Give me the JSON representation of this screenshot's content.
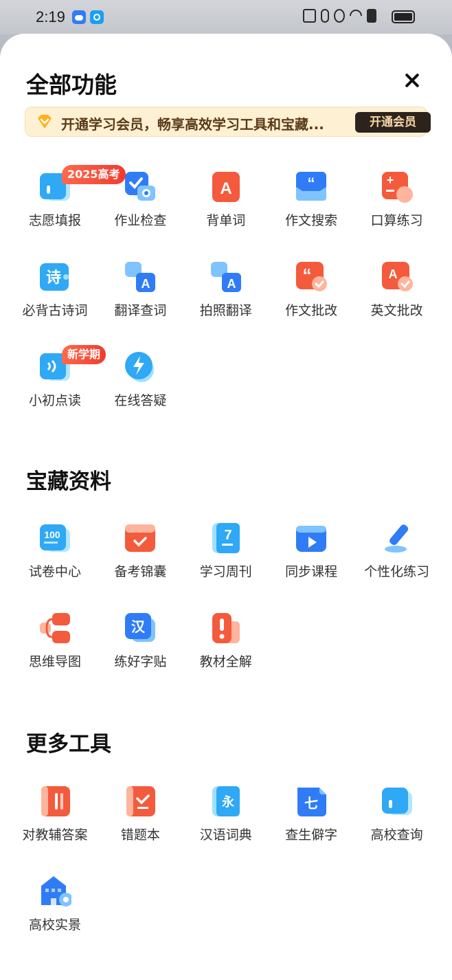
{
  "status_bar": {
    "time": "2:19",
    "icons": [
      "cloud-icon",
      "search-app-icon",
      "nfc-icon",
      "bluetooth-icon",
      "mute-icon",
      "wifi-icon",
      "alert-icon",
      "battery-icon"
    ]
  },
  "header": {
    "title": "全部功能",
    "close_icon": "close-icon"
  },
  "vip_banner": {
    "text": "开通学习会员，畅享高效学习工具和宝藏...",
    "button": "开通会员"
  },
  "functions": [
    {
      "label": "志愿填报",
      "icon": "volunteer-icon",
      "badge": "2025高考"
    },
    {
      "label": "作业检查",
      "icon": "homework-check-icon"
    },
    {
      "label": "背单词",
      "icon": "vocab-icon"
    },
    {
      "label": "作文搜索",
      "icon": "essay-search-icon"
    },
    {
      "label": "口算练习",
      "icon": "mental-math-icon"
    },
    {
      "label": "必背古诗词",
      "icon": "poetry-icon"
    },
    {
      "label": "翻译查词",
      "icon": "translate-icon"
    },
    {
      "label": "拍照翻译",
      "icon": "photo-translate-icon"
    },
    {
      "label": "作文批改",
      "icon": "essay-correct-icon"
    },
    {
      "label": "英文批改",
      "icon": "english-correct-icon"
    },
    {
      "label": "小初点读",
      "icon": "read-aloud-icon",
      "badge": "新学期"
    },
    {
      "label": "在线答疑",
      "icon": "online-qa-icon"
    }
  ],
  "treasure": {
    "title": "宝藏资料",
    "items": [
      {
        "label": "试卷中心",
        "icon": "exam-center-icon"
      },
      {
        "label": "备考锦囊",
        "icon": "exam-kit-icon"
      },
      {
        "label": "学习周刊",
        "icon": "weekly-icon"
      },
      {
        "label": "同步课程",
        "icon": "course-icon"
      },
      {
        "label": "个性化练习",
        "icon": "practice-icon"
      },
      {
        "label": "思维导图",
        "icon": "mindmap-icon"
      },
      {
        "label": "练好字贴",
        "icon": "copybook-icon"
      },
      {
        "label": "教材全解",
        "icon": "textbook-icon"
      }
    ]
  },
  "more_tools": {
    "title": "更多工具",
    "items": [
      {
        "label": "对教辅答案",
        "icon": "answers-icon"
      },
      {
        "label": "错题本",
        "icon": "mistakes-icon"
      },
      {
        "label": "汉语词典",
        "icon": "dictionary-icon"
      },
      {
        "label": "查生僻字",
        "icon": "rare-char-icon"
      },
      {
        "label": "高校查询",
        "icon": "university-search-icon"
      },
      {
        "label": "高校实景",
        "icon": "campus-view-icon"
      }
    ]
  },
  "colors": {
    "blue": "#2f7cf6",
    "orange": "#f45a3c",
    "vip_bg": "#fdf0d3",
    "vip_btn": "#2c231c"
  }
}
